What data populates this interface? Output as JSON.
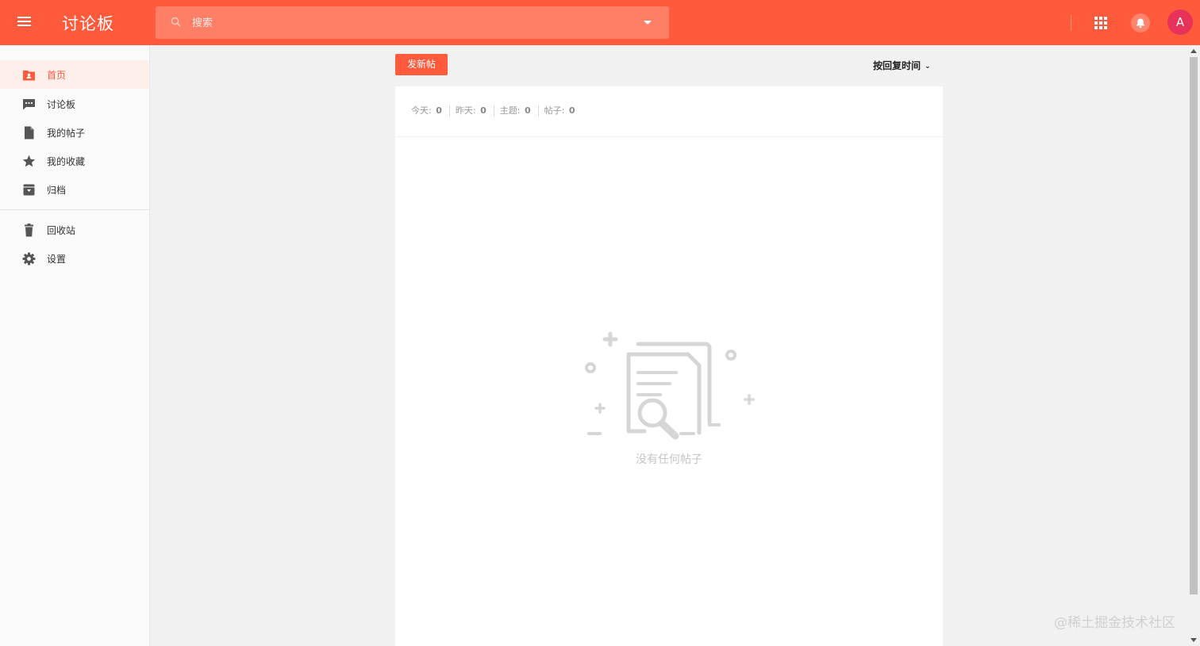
{
  "header": {
    "title": "讨论板",
    "search_placeholder": "搜索",
    "avatar_letter": "A",
    "accent_color": "#ff5a3c",
    "icons": [
      "menu-icon",
      "search-icon",
      "caret-down-icon",
      "apps-grid-icon",
      "bell-icon"
    ]
  },
  "sidebar": {
    "items": [
      {
        "label": "首页",
        "icon": "home-folder-icon",
        "active": true
      },
      {
        "label": "讨论板",
        "icon": "chat-icon",
        "active": false
      },
      {
        "label": "我的帖子",
        "icon": "document-icon",
        "active": false
      },
      {
        "label": "我的收藏",
        "icon": "star-icon",
        "active": false
      },
      {
        "label": "归档",
        "icon": "archive-icon",
        "active": false
      }
    ],
    "secondary_items": [
      {
        "label": "回收站",
        "icon": "trash-icon"
      },
      {
        "label": "设置",
        "icon": "gear-icon"
      }
    ]
  },
  "main": {
    "new_post_label": "发新帖",
    "sort_label": "按回复时间",
    "stats": [
      {
        "label": "今天:",
        "value": "0"
      },
      {
        "label": "昨天:",
        "value": "0"
      },
      {
        "label": "主题:",
        "value": "0"
      },
      {
        "label": "帖子:",
        "value": "0"
      }
    ],
    "empty_text": "没有任何帖子"
  },
  "watermark": "@稀土掘金技术社区"
}
